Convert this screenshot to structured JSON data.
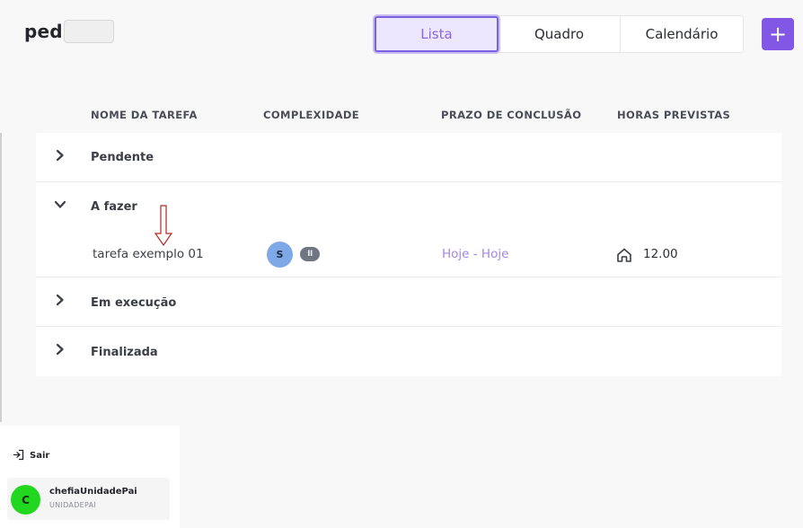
{
  "brand": {
    "text": "ped"
  },
  "view_tabs": [
    {
      "label": "Lista",
      "active": true
    },
    {
      "label": "Quadro",
      "active": false
    },
    {
      "label": "Calendário",
      "active": false
    }
  ],
  "add_button": {
    "label": "+"
  },
  "columns": [
    "NOME DA TAREFA",
    "COMPLEXIDADE",
    "PRAZO DE CONCLUSÃO",
    "HORAS PREVISTAS"
  ],
  "groups": [
    {
      "label": "Pendente",
      "expanded": false
    },
    {
      "label": "A fazer",
      "expanded": true
    },
    {
      "label": "Em execução",
      "expanded": false
    },
    {
      "label": "Finalizada",
      "expanded": false
    }
  ],
  "task": {
    "name": "tarefa exemplo 01",
    "assignee_initial": "S",
    "complexity": "II",
    "deadline": "Hoje - Hoje",
    "hours": "12.00"
  },
  "sidebar": {
    "logout_label": "Sair",
    "user": {
      "initial": "C",
      "name": "chefiaUnidadePai",
      "unit": "UNIDADEPAI"
    }
  },
  "colors": {
    "accent": "#8257e5",
    "active_tab_bg": "#ede6ff",
    "deadline_text": "#a486e6",
    "user_avatar": "#22d81e",
    "assignee_avatar": "#7fa8e6"
  }
}
